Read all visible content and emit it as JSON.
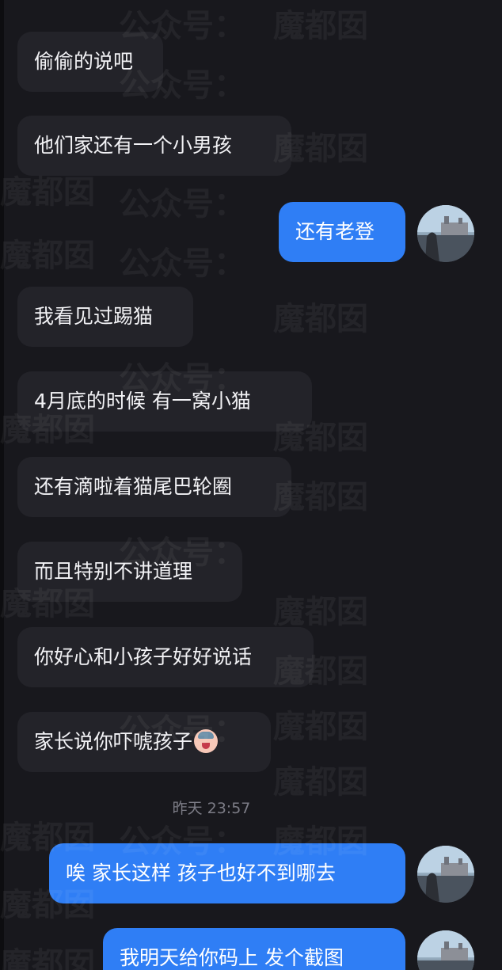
{
  "messages": [
    {
      "side": "in",
      "text": "偷偷的说吧"
    },
    {
      "side": "in",
      "text": "他们家还有一个小男孩"
    },
    {
      "side": "out",
      "text": "还有老登"
    },
    {
      "side": "in",
      "text": "我看见过踢猫"
    },
    {
      "side": "in",
      "text": "4月底的时候 有一窝小猫"
    },
    {
      "side": "in",
      "text": "还有滴啦着猫尾巴轮圈"
    },
    {
      "side": "in",
      "text": "而且特别不讲道理"
    },
    {
      "side": "in",
      "text": "你好心和小孩子好好说话"
    },
    {
      "side": "in",
      "text": "家长说你吓唬孩子",
      "emoji": "crying-face-emoji"
    },
    {
      "side": "out",
      "text": "唉 家长这样 孩子也好不到哪去"
    },
    {
      "side": "out",
      "text": "我明天给你码上 发个截图"
    }
  ],
  "timestamp": "昨天 23:57",
  "watermark": {
    "text_a": "公众号：",
    "text_b": "魔都囡"
  },
  "colors": {
    "background": "#18181d",
    "incoming_bubble": "#232329",
    "outgoing_bubble": "#2f7ef5"
  }
}
